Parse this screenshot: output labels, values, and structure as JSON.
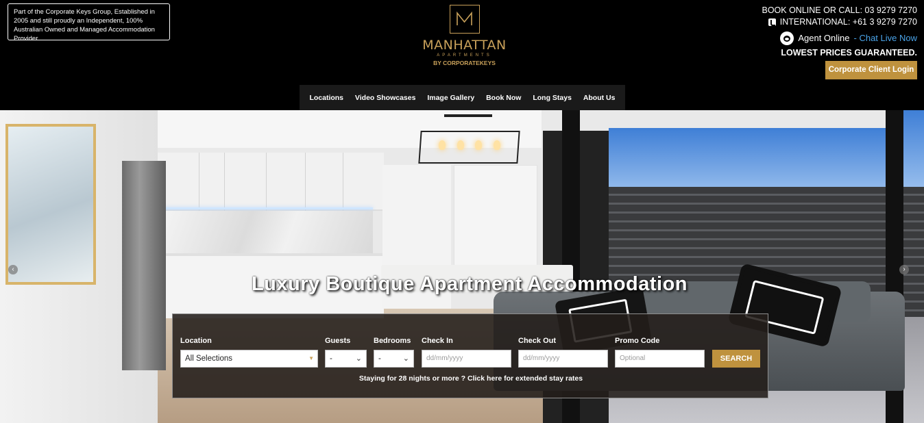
{
  "header": {
    "group_note": "Part of the Corporate Keys Group, Established in 2005 and still proudly an Independent, 100% Australian Owned and Managed Accommodation Provider.",
    "logo": {
      "letter": "M",
      "name": "MANHATTAN",
      "sub": "APARTMENTS",
      "by": "BY CORPORATEKEYS"
    },
    "contact": {
      "book_online": "BOOK ONLINE OR CALL: 03 9279 7270",
      "international": "INTERNATIONAL: +61 3 9279 7270",
      "agent_status": "Agent Online",
      "chat_link": "- Chat Live Now",
      "lowest_prices": "LOWEST PRICES GUARANTEED."
    },
    "client_login_label": "Corporate Client Login",
    "icons": {
      "phone": "phone-icon",
      "agent": "agent-avatar-icon"
    }
  },
  "nav": {
    "items": [
      {
        "label": "Locations"
      },
      {
        "label": "Video Showcases"
      },
      {
        "label": "Image Gallery"
      },
      {
        "label": "Book Now"
      },
      {
        "label": "Long Stays"
      },
      {
        "label": "About Us"
      }
    ]
  },
  "hero": {
    "title": "Luxury Boutique Apartment Accommodation",
    "prev_arrow": "‹",
    "next_arrow": "›"
  },
  "search": {
    "location_label": "Location",
    "location_value": "All Selections",
    "guests_label": "Guests",
    "guests_value": "-",
    "bedrooms_label": "Bedrooms",
    "bedrooms_value": "-",
    "checkin_label": "Check In",
    "checkin_placeholder": "dd/mm/yyyy",
    "checkout_label": "Check Out",
    "checkout_placeholder": "dd/mm/yyyy",
    "promo_label": "Promo Code",
    "promo_placeholder": "Optional",
    "search_button": "SEARCH",
    "extended_stay_link": "Staying for 28 nights or more ? Click here for extended stay rates"
  },
  "colors": {
    "accent_gold": "#bf923e",
    "logo_gold": "#c9a15a",
    "chat_blue": "#4aa3e8",
    "header_bg": "#000000",
    "nav_bg": "#1a1a1a"
  }
}
